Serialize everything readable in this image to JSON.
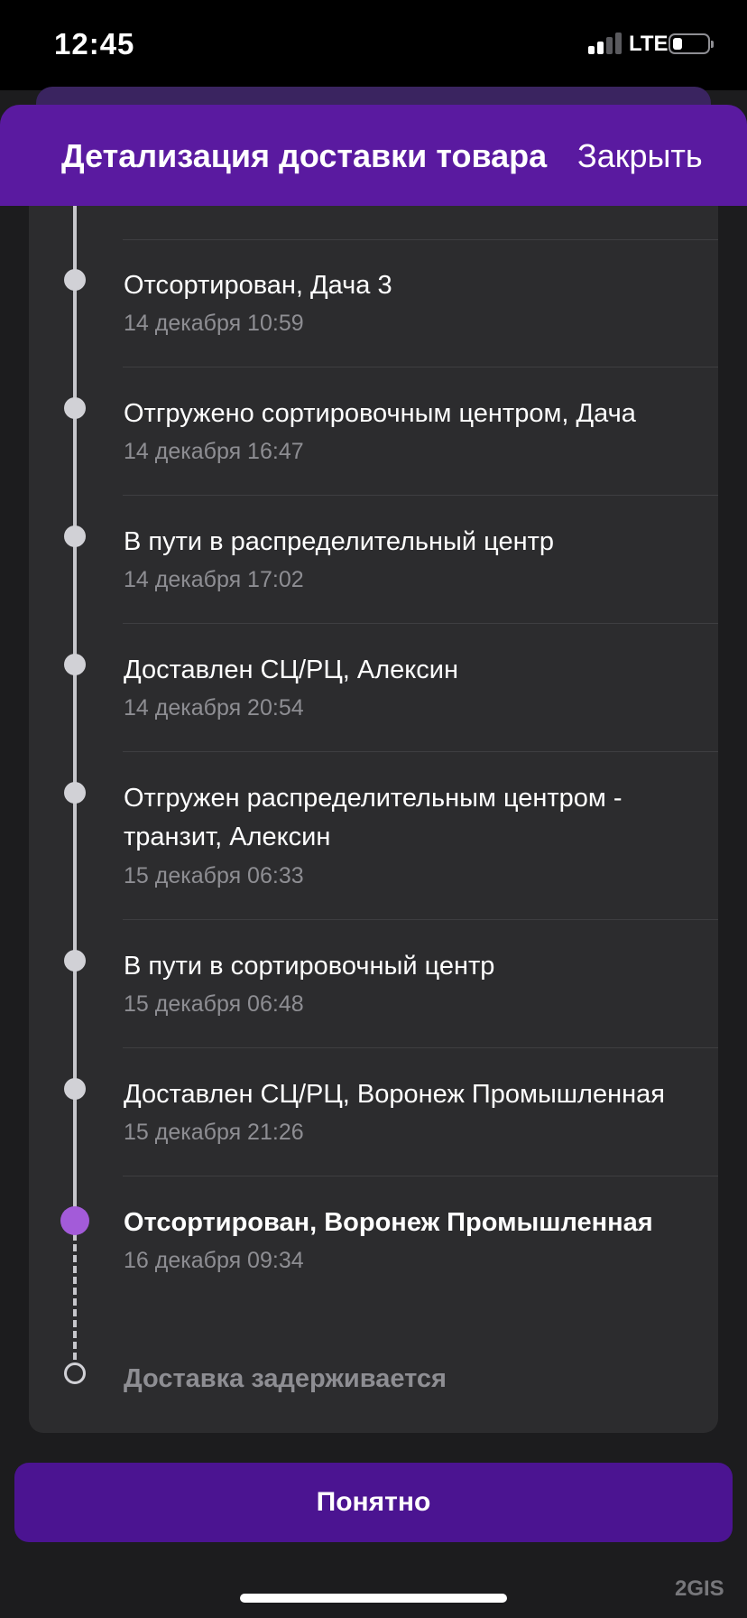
{
  "status_bar": {
    "time": "12:45",
    "network": "LTE",
    "battery_level": 0.2,
    "signal_bars_active": 2,
    "signal_bars_total": 4
  },
  "header": {
    "title": "Детализация доставки товара",
    "close_label": "Закрыть",
    "color": "#5a1aa0"
  },
  "events": [
    {
      "title": "Отсортирован, Дача 3",
      "date": "14 декабря 10:59"
    },
    {
      "title": "Отгружено сортировочным центром, Дача",
      "date": "14 декабря 16:47"
    },
    {
      "title": "В пути в распределительный центр",
      "date": "14 декабря 17:02"
    },
    {
      "title": "Доставлен СЦ/РЦ, Алексин",
      "date": "14 декабря 20:54"
    },
    {
      "title": "Отгружен распределительным центром - транзит, Алексин",
      "date": "15 декабря 06:33"
    },
    {
      "title": "В пути в сортировочный центр",
      "date": "15 декабря 06:48"
    },
    {
      "title": "Доставлен СЦ/РЦ, Воронеж Промышленная",
      "date": "15 декабря 21:26"
    },
    {
      "title": "Отсортирован, Воронеж Промышленная",
      "date": "16 декабря 09:34",
      "current": true
    }
  ],
  "pending_event": {
    "title": "Доставка задерживается"
  },
  "ok_button": {
    "label": "Понятно",
    "color": "#4b1491"
  },
  "watermark": "2GIS",
  "accent_color": "#a35bd9"
}
